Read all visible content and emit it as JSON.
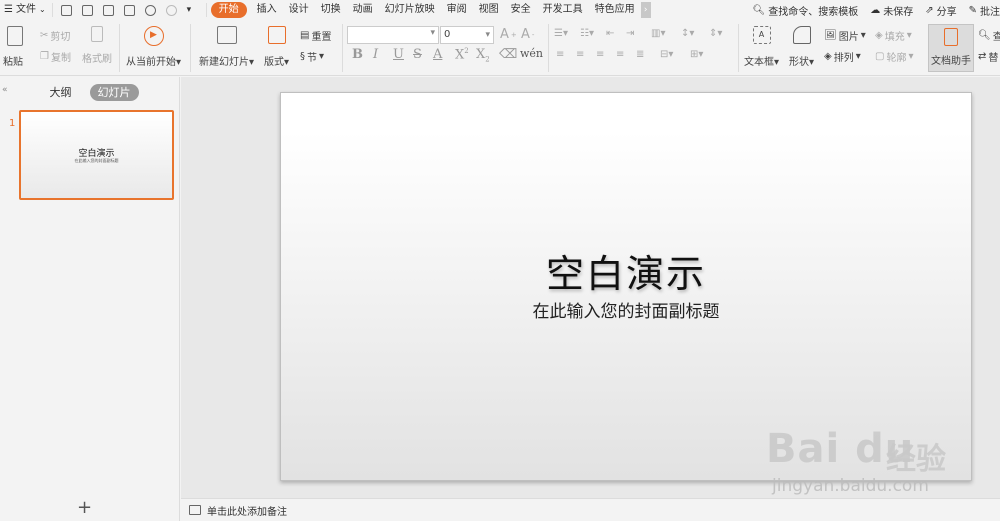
{
  "menubar": {
    "file": "文件",
    "tabs": [
      "开始",
      "插入",
      "设计",
      "切换",
      "动画",
      "幻灯片放映",
      "审阅",
      "视图",
      "安全",
      "开发工具",
      "特色应用"
    ],
    "active_tab": "开始",
    "search": "查找命令、搜索模板",
    "unsaved": "未保存",
    "share": "分享",
    "comment": "批注"
  },
  "ribbon": {
    "paste": "粘贴",
    "cut": "剪切",
    "copy": "复制",
    "format_painter": "格式刷",
    "play_from_current": "从当前开始",
    "new_slide": "新建幻灯片",
    "layout": "版式",
    "reset": "重置",
    "section": "节",
    "font_size_value": "0",
    "text_box": "文本框",
    "shape": "形状",
    "picture": "图片",
    "fill": "填充",
    "arrange": "排列",
    "outline": "轮廓",
    "doc_assistant": "文档助手",
    "find": "查",
    "replace": "替"
  },
  "leftpanel": {
    "tab_outline": "大纲",
    "tab_slides": "幻灯片",
    "slide_number": "1",
    "thumb_title": "空白演示",
    "thumb_subtitle": "在此输入您的封面副标题",
    "add_button": "+"
  },
  "slide": {
    "title": "空白演示",
    "subtitle": "在此输入您的封面副标题"
  },
  "notes": {
    "placeholder": "单击此处添加备注"
  },
  "watermark": {
    "brand": "Bai du",
    "brand_cn": "经验",
    "url": "jingyan.baidu.com"
  },
  "colors": {
    "accent": "#e86e2b",
    "workspace": "#e8e8e8",
    "chrome": "#f3f3f3"
  }
}
